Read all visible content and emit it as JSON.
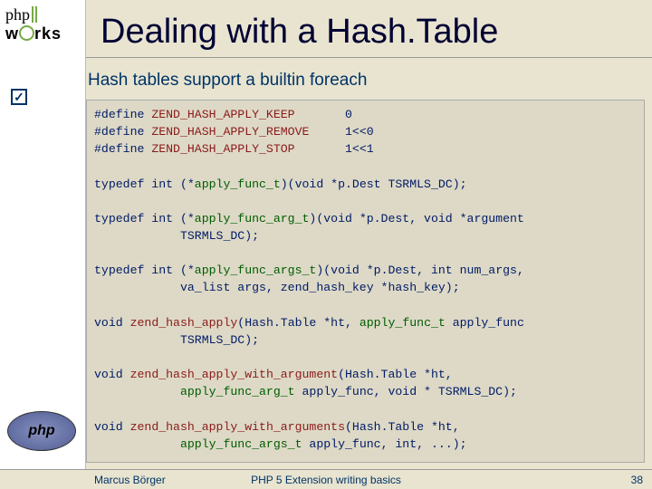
{
  "logo": {
    "line1": "php",
    "line2_pre": "w",
    "line2_post": "rks",
    "badge": "php"
  },
  "checkmark": "✓",
  "title": "Dealing with a Hash.Table",
  "subhead": "Hash tables support a builtin foreach",
  "code": {
    "l1a": "#define ",
    "l1b": "ZEND_HASH_APPLY_KEEP       ",
    "l1c": "0",
    "l2a": "#define ",
    "l2b": "ZEND_HASH_APPLY_REMOVE     ",
    "l2c": "1<<0",
    "l3a": "#define ",
    "l3b": "ZEND_HASH_APPLY_STOP       ",
    "l3c": "1<<1",
    "l5a": "typedef int ",
    "l5b": "(*",
    "l5c": "apply_func_t",
    "l5d": ")(void *p.Dest TSRMLS_DC);",
    "l7a": "typedef int ",
    "l7b": "(*",
    "l7c": "apply_func_arg_t",
    "l7d": ")(void *p.Dest, void *argument",
    "l8": "            TSRMLS_DC);",
    "l10a": "typedef int ",
    "l10b": "(*",
    "l10c": "apply_func_args_t",
    "l10d": ")(void *p.Dest, int num_args,",
    "l11": "            va_list args, zend_hash_key *hash_key);",
    "l13a": "void ",
    "l13b": "zend_hash_apply",
    "l13c": "(Hash.Table *ht, ",
    "l13d": "apply_func_t",
    "l13e": " apply_func",
    "l14": "            TSRMLS_DC);",
    "l16a": "void ",
    "l16b": "zend_hash_apply_with_argument",
    "l16c": "(Hash.Table *ht,",
    "l17a": "            ",
    "l17b": "apply_func_arg_t",
    "l17c": " apply_func, void * TSRMLS_DC);",
    "l19a": "void ",
    "l19b": "zend_hash_apply_with_arguments",
    "l19c": "(Hash.Table *ht,",
    "l20a": "            ",
    "l20b": "apply_func_args_t",
    "l20c": " apply_func, int, ...);"
  },
  "footer": {
    "left": "Marcus Börger",
    "center": "PHP 5 Extension writing basics",
    "right": "38"
  }
}
